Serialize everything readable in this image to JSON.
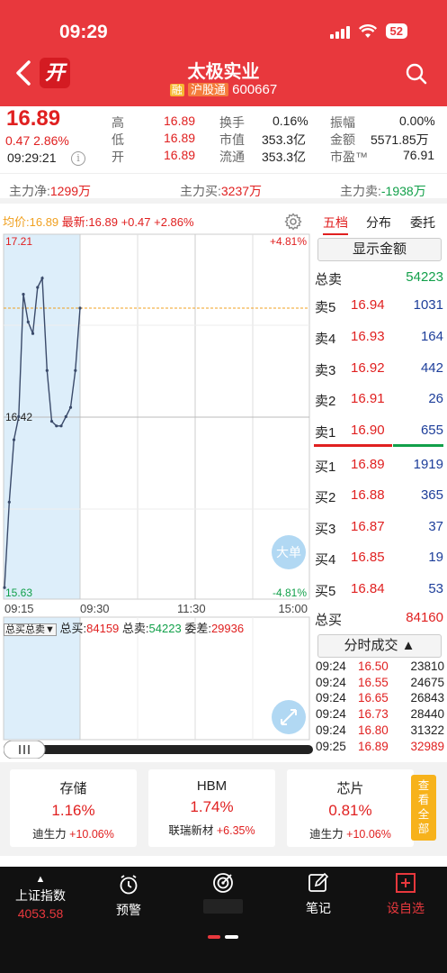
{
  "status_bar": {
    "time": "09:29",
    "battery": "52"
  },
  "header": {
    "title": "太极实业",
    "badge_rong": "融",
    "badge_hgt": "沪股通",
    "code": "600667",
    "kai_label": "开"
  },
  "quote": {
    "price": "16.89",
    "change": "0.47",
    "change_pct": "2.86%",
    "time": "09:29:21",
    "info_icon": "i",
    "fields": [
      {
        "label": "高",
        "value": "16.89"
      },
      {
        "label": "低",
        "value": "16.89"
      },
      {
        "label": "开",
        "value": "16.89"
      }
    ],
    "fields2": [
      {
        "label": "换手",
        "value": "0.16%"
      },
      {
        "label": "市值",
        "value": "353.3亿"
      },
      {
        "label": "流通",
        "value": "353.3亿"
      }
    ],
    "fields3": [
      {
        "label": "振幅",
        "value": "0.00%"
      },
      {
        "label": "金额",
        "value": "5571.85万"
      },
      {
        "label": "市盈™",
        "value": "76.91"
      }
    ]
  },
  "flow": {
    "net_label": "主力净:",
    "net_value": "1299万",
    "buy_label": "主力买:",
    "buy_value": "3237万",
    "sell_label": "主力卖:",
    "sell_value": "-1938万"
  },
  "chart": {
    "avg_label": "均价:",
    "avg_value": "16.89",
    "latest_label": "最新:",
    "latest_value": "16.89",
    "chg": "+0.47",
    "chg_pct": "+2.86%",
    "ymax_label": "17.21",
    "ymid_label": "16.42",
    "ymin_label": "15.63",
    "pct_top": "+4.81%",
    "pct_bottom": "-4.81%",
    "times": [
      "09:15",
      "09:30",
      "11:30",
      "15:00"
    ],
    "big_order_label": "大单"
  },
  "chart_data": {
    "type": "line",
    "title": "",
    "xlabel": "",
    "ylabel": "",
    "ylim": [
      15.63,
      17.21
    ],
    "x": [
      "09:15",
      "09:30",
      "11:30",
      "15:00"
    ],
    "series": [
      {
        "values": [
          15.68,
          16.05,
          16.32,
          16.42,
          16.95,
          16.83,
          16.78,
          16.98,
          17.02,
          16.62,
          16.4,
          16.38,
          16.38,
          16.42,
          16.46,
          16.62,
          16.89
        ]
      }
    ]
  },
  "volume": {
    "selector": "总买总卖",
    "buy_label": "总买:",
    "buy_value": "84159",
    "sell_label": "总卖:",
    "sell_value": "54223",
    "diff_label": "委差:",
    "diff_value": "29936"
  },
  "orderbook": {
    "tabs": [
      "五档",
      "分布",
      "委托"
    ],
    "show_amount": "显示金额",
    "total_sell_label": "总卖",
    "total_sell": "54223",
    "asks": [
      {
        "label": "卖5",
        "price": "16.94",
        "vol": "1031"
      },
      {
        "label": "卖4",
        "price": "16.93",
        "vol": "164"
      },
      {
        "label": "卖3",
        "price": "16.92",
        "vol": "442"
      },
      {
        "label": "卖2",
        "price": "16.91",
        "vol": "26"
      },
      {
        "label": "卖1",
        "price": "16.90",
        "vol": "655"
      }
    ],
    "bids": [
      {
        "label": "买1",
        "price": "16.89",
        "vol": "1919"
      },
      {
        "label": "买2",
        "price": "16.88",
        "vol": "365"
      },
      {
        "label": "买3",
        "price": "16.87",
        "vol": "37"
      },
      {
        "label": "买4",
        "price": "16.85",
        "vol": "19"
      },
      {
        "label": "买5",
        "price": "16.84",
        "vol": "53"
      }
    ],
    "total_buy_label": "总买",
    "total_buy": "84160",
    "trade_btn": "分时成交"
  },
  "trades": [
    {
      "time": "09:24",
      "price": "16.50",
      "vol": "23810"
    },
    {
      "time": "09:24",
      "price": "16.55",
      "vol": "24675"
    },
    {
      "time": "09:24",
      "price": "16.65",
      "vol": "26843"
    },
    {
      "time": "09:24",
      "price": "16.73",
      "vol": "28440"
    },
    {
      "time": "09:24",
      "price": "16.80",
      "vol": "31322"
    },
    {
      "time": "09:25",
      "price": "16.89",
      "vol": "32989"
    }
  ],
  "sectors": [
    {
      "name": "存储",
      "pct": "1.16%",
      "leader": "迪生力",
      "leader_pct": "+10.06%"
    },
    {
      "name": "HBM",
      "pct": "1.74%",
      "leader": "联瑞新材",
      "leader_pct": "+6.35%"
    },
    {
      "name": "芯片",
      "pct": "0.81%",
      "leader": "迪生力",
      "leader_pct": "+10.06%"
    }
  ],
  "see_all": [
    "查",
    "看",
    "全",
    "部"
  ],
  "nav": {
    "index_name": "上证指数",
    "index_value": "4053.58",
    "alert": "预警",
    "note": "笔记",
    "add": "设自选"
  },
  "colors": {
    "up": "#e02020",
    "down": "#12a04a",
    "header": "#e8383d",
    "volume_blue": "#1d3e9a"
  }
}
